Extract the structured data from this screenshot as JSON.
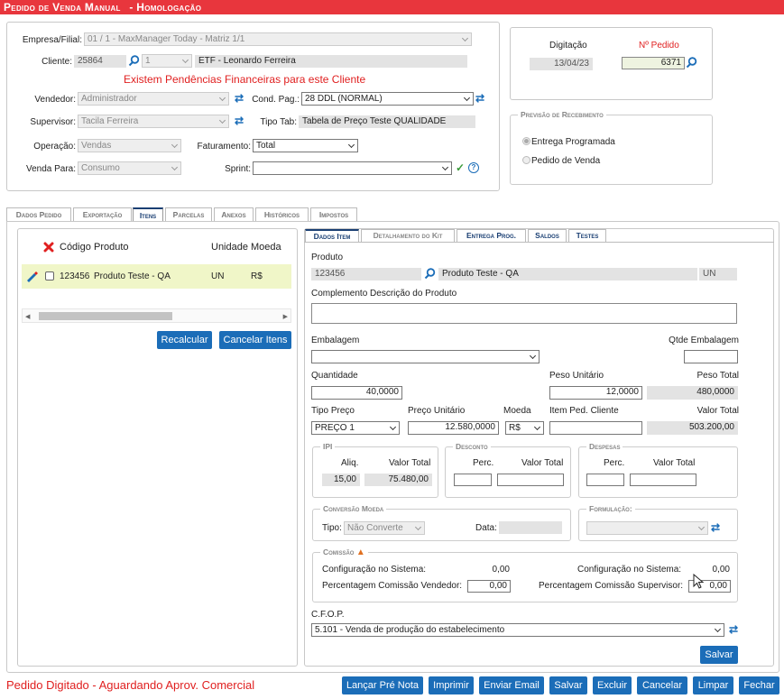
{
  "title": "Pedido de Venda Manual",
  "title_suffix": "- Homologação",
  "header": {
    "empresa_label": "Empresa/Filial:",
    "empresa_value": "01 / 1 - MaxManager Today - Matriz 1/1",
    "cliente_label": "Cliente:",
    "cliente_code": "25864",
    "cliente_seq": "1",
    "cliente_name": "ETF - Leonardo Ferreira",
    "warning": "Existem Pendências Financeiras para este Cliente",
    "vendedor_label": "Vendedor:",
    "vendedor_value": "Administrador",
    "condpag_label": "Cond. Pag.:",
    "condpag_value": "28 DDL (NORMAL)",
    "supervisor_label": "Supervisor:",
    "supervisor_value": "Tacila Ferreira",
    "tipotab_label": "Tipo Tab:",
    "tipotab_value": "Tabela de Preço Teste QUALIDADE",
    "operacao_label": "Operação:",
    "operacao_value": "Vendas",
    "faturamento_label": "Faturamento:",
    "faturamento_value": "Total",
    "vendapara_label": "Venda Para:",
    "vendapara_value": "Consumo",
    "sprint_label": "Sprint:",
    "sprint_value": ""
  },
  "digitacao": {
    "digitacao_label": "Digitação",
    "digitacao_value": "13/04/23",
    "pedido_label": "Nº Pedido",
    "pedido_value": "6371"
  },
  "previsao": {
    "legend": "Previsão de Recebimento",
    "opt1": "Entrega Programada",
    "opt2": "Pedido de Venda"
  },
  "tabs": [
    "Dados Pedido",
    "Exportação",
    "Itens",
    "Parcelas",
    "Anexos",
    "Históricos",
    "Impostos"
  ],
  "items_table": {
    "headers": [
      "Código",
      "Produto",
      "Unidade",
      "Moeda"
    ],
    "row": {
      "codigo": "123456",
      "produto": "Produto Teste - QA",
      "unidade": "UN",
      "moeda": "R$"
    },
    "recalcular": "Recalcular",
    "cancelar": "Cancelar Itens"
  },
  "subtabs": [
    "Dados Item",
    "Detalhamento do Kit",
    "Entrega Prog.",
    "Saldos",
    "Testes"
  ],
  "item": {
    "produto_label": "Produto",
    "produto_code": "123456",
    "produto_name": "Produto Teste - QA",
    "produto_un": "UN",
    "complemento_label": "Complemento Descrição do Produto",
    "embalagem_label": "Embalagem",
    "qtde_embalagem_label": "Qtde Embalagem",
    "quantidade_label": "Quantidade",
    "quantidade_value": "40,0000",
    "peso_unit_label": "Peso Unitário",
    "peso_unit_value": "12,0000",
    "peso_total_label": "Peso Total",
    "peso_total_value": "480,0000",
    "tipo_preco_label": "Tipo Preço",
    "tipo_preco_value": "PREÇO 1",
    "preco_unit_label": "Preço Unitário",
    "preco_unit_value": "12.580,0000",
    "moeda_label": "Moeda",
    "moeda_value": "R$",
    "item_ped_label": "Item Ped. Cliente",
    "valor_total_label": "Valor Total",
    "valor_total_value": "503.200,00",
    "ipi_legend": "IPI",
    "ipi_aliq_label": "Aliq.",
    "ipi_valor_label": "Valor Total",
    "ipi_aliq_value": "15,00",
    "ipi_valor_value": "75.480,00",
    "desconto_legend": "Desconto",
    "desconto_perc_label": "Perc.",
    "desconto_valor_label": "Valor Total",
    "despesas_legend": "Despesas",
    "despesas_perc_label": "Perc.",
    "despesas_valor_label": "Valor Total",
    "conversao_legend": "Conversão Moeda",
    "tipo_label": "Tipo:",
    "tipo_value": "Não Converte",
    "data_label": "Data:",
    "formulacao_legend": "Formulação:",
    "comissao_legend": "Comissão",
    "config_sistema_label": "Configuração no Sistema:",
    "config_sistema_value1": "0,00",
    "config_sistema_value2": "0,00",
    "perc_vendedor_label": "Percentagem Comissão Vendedor:",
    "perc_vendedor_value": "0,00",
    "perc_supervisor_label": "Percentagem Comissão Supervisor:",
    "perc_supervisor_value": "0,00",
    "cfop_label": "C.F.O.P.",
    "cfop_value": "5.101 - Venda de produção do estabelecimento",
    "salvar": "Salvar"
  },
  "status": "Pedido Digitado - Aguardando Aprov. Comercial",
  "footer_buttons": [
    "Lançar Pré Nota",
    "Imprimir",
    "Enviar Email",
    "Salvar",
    "Excluir",
    "Cancelar",
    "Limpar",
    "Fechar"
  ],
  "colors": {
    "title_bg": "#e8363d",
    "button": "#1b6db8",
    "warning": "#e02020",
    "tab_active": "#1a3f73",
    "row_highlight": "#f0f6c8"
  }
}
